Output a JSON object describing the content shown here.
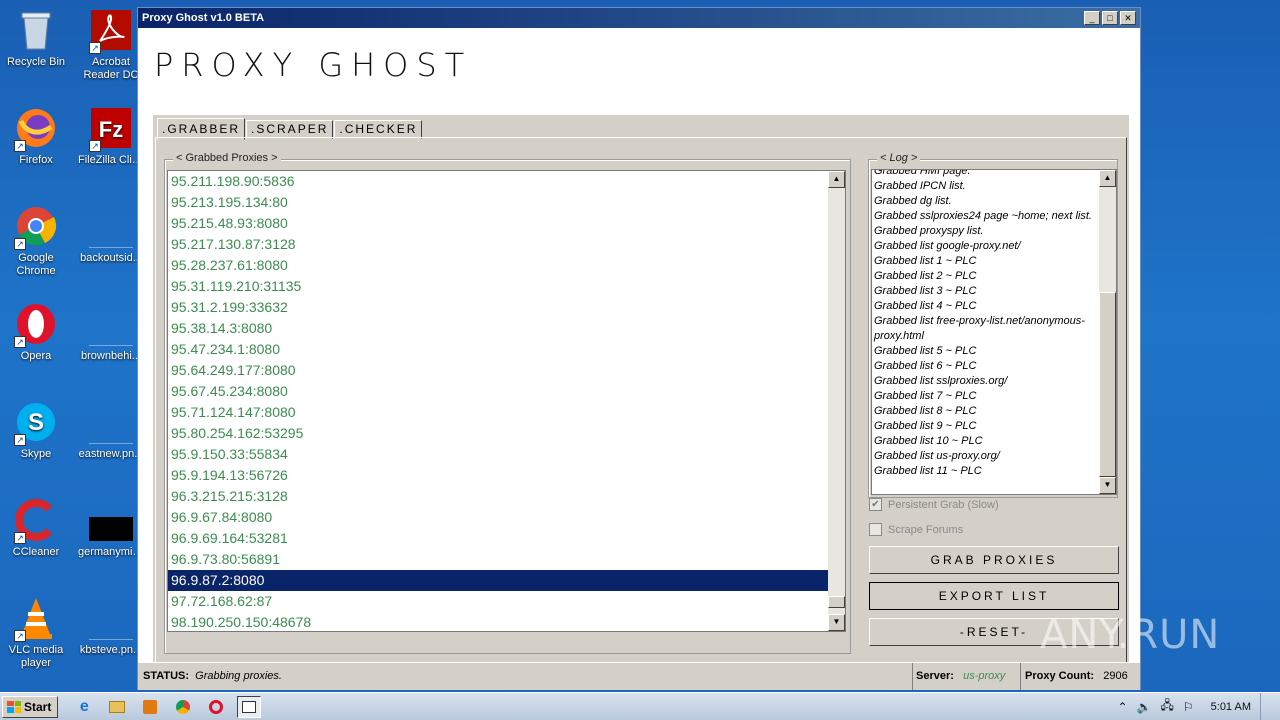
{
  "desktop": {
    "col1": [
      {
        "label": "Recycle Bin",
        "icon": "recycle-bin-icon"
      },
      {
        "label": "Firefox",
        "icon": "firefox-icon"
      },
      {
        "label": "Google Chrome",
        "icon": "chrome-icon"
      },
      {
        "label": "Opera",
        "icon": "opera-icon"
      },
      {
        "label": "Skype",
        "icon": "skype-icon"
      },
      {
        "label": "CCleaner",
        "icon": "ccleaner-icon"
      },
      {
        "label": "VLC media player",
        "icon": "vlc-icon"
      }
    ],
    "col2": [
      {
        "label": "Acrobat Reader DC",
        "icon": "acrobat-icon"
      },
      {
        "label": "FileZilla Client",
        "icon": "filezilla-icon"
      },
      {
        "label": "backoutsid...",
        "icon": "file-icon"
      },
      {
        "label": "brownbehi...",
        "icon": "file-icon"
      },
      {
        "label": "eastnew.pn...",
        "icon": "file-icon"
      },
      {
        "label": "germanymin...",
        "icon": "image-file-icon"
      },
      {
        "label": "kbsteve.pn...",
        "icon": "file-icon"
      }
    ]
  },
  "window": {
    "title": "Proxy Ghost v1.0 BETA",
    "controls": {
      "minimize": "_",
      "maximize": "□",
      "close": "✕"
    },
    "logo": "PROXY GHOST"
  },
  "tabs": [
    {
      "label": ".GRABBER",
      "active": true
    },
    {
      "label": ".SCRAPER",
      "active": false
    },
    {
      "label": ".CHECKER",
      "active": false
    }
  ],
  "grabbed": {
    "legend": "< Grabbed Proxies >",
    "rows": [
      "95.211.198.90:5836",
      "95.213.195.134:80",
      "95.215.48.93:8080",
      "95.217.130.87:3128",
      "95.28.237.61:8080",
      "95.31.119.210:31135",
      "95.31.2.199:33632",
      "95.38.14.3:8080",
      "95.47.234.1:8080",
      "95.64.249.177:8080",
      "95.67.45.234:8080",
      "95.71.124.147:8080",
      "95.80.254.162:53295",
      "95.9.150.33:55834",
      "95.9.194.13:56726",
      "96.3.215.215:3128",
      "96.9.67.84:8080",
      "96.9.69.164:53281",
      "96.9.73.80:56891",
      "96.9.87.2:8080",
      "97.72.168.62:87",
      "98.190.250.150:48678"
    ],
    "selected_index": 19
  },
  "log": {
    "legend": "< Log >",
    "lines": [
      "Grabbed HMI page.",
      "Grabbed IPCN list.",
      "Grabbed dg list.",
      "Grabbed sslproxies24 page ~home; next list.",
      "Grabbed proxyspy list.",
      "Grabbed list google-proxy.net/",
      "Grabbed list 1 ~ PLC",
      "Grabbed list 2 ~ PLC",
      "Grabbed list 3 ~ PLC",
      "Grabbed list 4 ~ PLC",
      "Grabbed list free-proxy-list.net/anonymous-proxy.html",
      "Grabbed list 5 ~ PLC",
      "Grabbed list 6 ~ PLC",
      "Grabbed list sslproxies.org/",
      "Grabbed list 7 ~ PLC",
      "Grabbed list 8 ~ PLC",
      "Grabbed list 9 ~ PLC",
      "Grabbed list 10 ~ PLC",
      "Grabbed list us-proxy.org/",
      "Grabbed list 11 ~ PLC"
    ]
  },
  "options": {
    "persistent_grab": {
      "label": "Persistent Grab (Slow)",
      "checked": true
    },
    "scrape_forums": {
      "label": "Scrape Forums",
      "checked": false
    }
  },
  "buttons": {
    "grab": "GRAB PROXIES",
    "export": "EXPORT LIST",
    "reset": "-RESET-"
  },
  "status": {
    "label": "STATUS:",
    "text": "Grabbing proxies.",
    "server_label": "Server:",
    "server": "us-proxy",
    "count_label": "Proxy Count:",
    "count": "2906"
  },
  "watermark": "ANY.RUN",
  "taskbar": {
    "start": "Start",
    "clock": "5:01 AM",
    "apps": [
      "ie-icon",
      "explorer-icon",
      "media-player-icon",
      "chrome-icon",
      "opera-icon",
      "app-window-icon"
    ]
  },
  "colors": {
    "accent": "#0a246a",
    "proxy_text": "#3c8c50",
    "panel": "#d4d0c8"
  }
}
